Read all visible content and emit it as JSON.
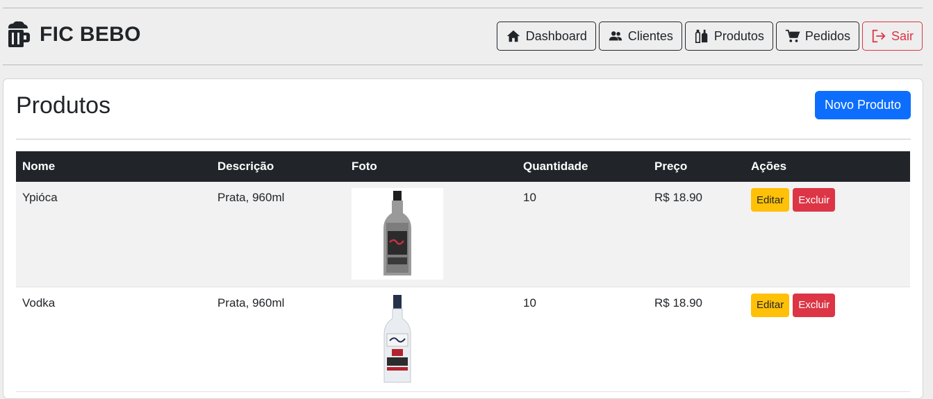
{
  "brand": {
    "title": "FIC BEBO",
    "icon": "beer-mug-icon"
  },
  "nav": [
    {
      "label": "Dashboard",
      "icon": "home-icon"
    },
    {
      "label": "Clientes",
      "icon": "users-icon"
    },
    {
      "label": "Produtos",
      "icon": "bottles-icon"
    },
    {
      "label": "Pedidos",
      "icon": "cart-icon"
    },
    {
      "label": "Sair",
      "icon": "logout-icon",
      "color": "#dc3545"
    }
  ],
  "page": {
    "title": "Produtos",
    "new_button": "Novo Produto"
  },
  "table": {
    "headers": [
      "Nome",
      "Descrição",
      "Foto",
      "Quantidade",
      "Preço",
      "Ações"
    ],
    "rows": [
      {
        "nome": "Ypióca",
        "descricao": "Prata, 960ml",
        "foto": "ypioca-bottle",
        "quantidade": "10",
        "preco": "R$ 18.90",
        "editar": "Editar",
        "excluir": "Excluir"
      },
      {
        "nome": "Vodka",
        "descricao": "Prata, 960ml",
        "foto": "vodka-bottle",
        "quantidade": "10",
        "preco": "R$ 18.90",
        "editar": "Editar",
        "excluir": "Excluir"
      }
    ]
  },
  "colors": {
    "primary": "#0d6efd",
    "warning": "#ffc107",
    "danger": "#dc3545",
    "dark": "#212529"
  }
}
